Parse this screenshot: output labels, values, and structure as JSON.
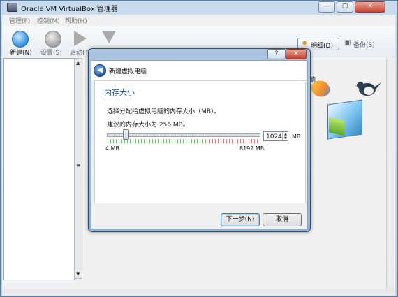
{
  "window": {
    "title": "Oracle VM VirtualBox 管理器"
  },
  "menu": [
    {
      "label": "管理(F)"
    },
    {
      "label": "控制(M)"
    },
    {
      "label": "帮助(H)"
    }
  ],
  "toolbar": {
    "new": "新建(N)",
    "settings": "设置(S)",
    "start": "启动(T)",
    "details": "明细(D)",
    "snapshots": "备份(S)"
  },
  "dialog": {
    "title": "新建虚拟电脑",
    "help": "?",
    "close": "✕",
    "page_title": "内存大小",
    "description": "选择分配给虚拟电脑的内存大小（MB）。",
    "recommended": "建议的内存大小为 256 MB。",
    "memory_value": "1024",
    "unit": "MB",
    "slider_min_label": "4 MB",
    "slider_max_label": "8192 MB",
    "next": "下一步(N)",
    "cancel": "取消",
    "slider": {
      "min_mb": 4,
      "max_mb": 8192,
      "value_mb": 1024
    }
  },
  "right_pane": {
    "partial_text": "脑"
  }
}
